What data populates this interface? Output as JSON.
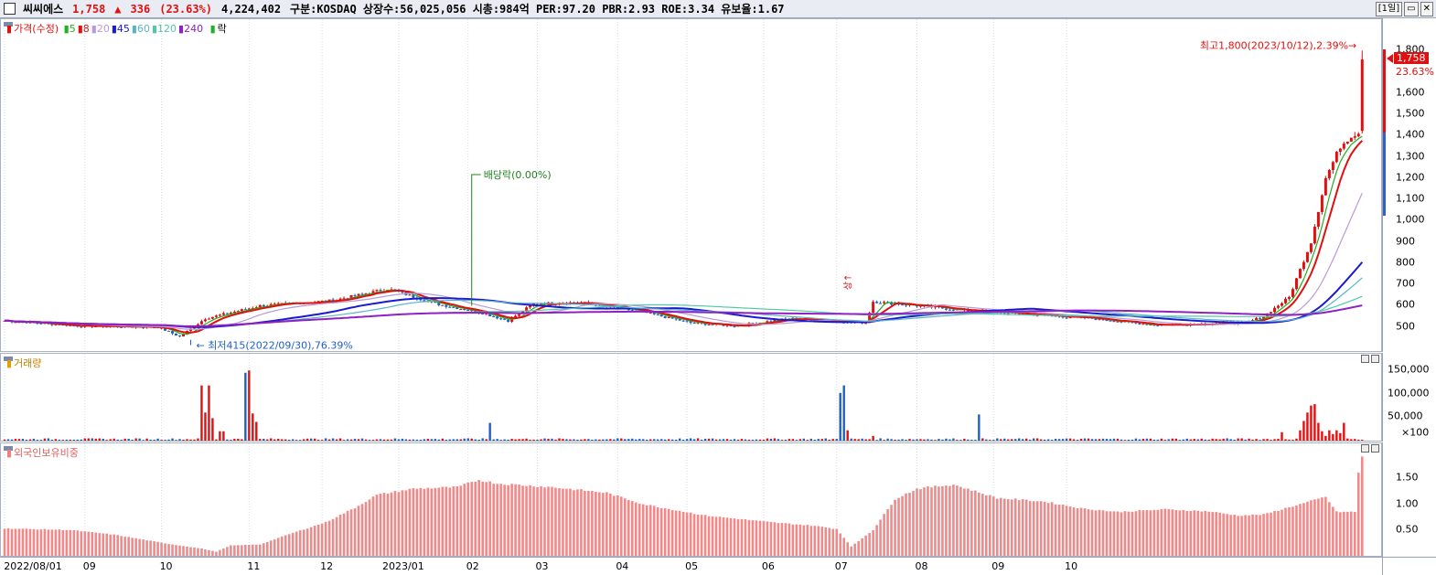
{
  "header": {
    "name": "씨씨에스",
    "price": "1,758",
    "change_arrow": "▲",
    "change": "336",
    "change_pct": "(23.63%)",
    "volume": "4,224,402",
    "info": "구분:KOSDAQ 상장수:56,025,056 시총:984억 PER:97.20 PBR:2.93 ROE:3.34 유보율:1.67",
    "period_button": "[1일]",
    "min_button": "▭",
    "close_button": "✕"
  },
  "legend": {
    "price_label": "가격(수정)",
    "ma": [
      "5",
      "8",
      "20",
      "45",
      "60",
      "120",
      "240"
    ],
    "ma_colors": [
      "#20b020",
      "#e01010",
      "#b89ad6",
      "#1a1ad0",
      "#5ab4c8",
      "#52c8a8",
      "#9020c0"
    ],
    "fall_label": "락",
    "volume_label": "거래량",
    "foreign_label": "외국인보유비중"
  },
  "annotations": {
    "high": "최고1,800(2023/10/12),2.39%",
    "low": "최저415(2022/09/30),76.39%",
    "dividend": "배당락(0.00%)",
    "up_marker": "상",
    "current_price": "1,758",
    "current_pct": "23.63%"
  },
  "chart_data": [
    {
      "type": "candlestick",
      "title": "가격(수정)",
      "ylim": [
        400,
        1870
      ],
      "yticks": [
        500,
        600,
        700,
        800,
        900,
        1000,
        1100,
        1200,
        1300,
        1400,
        1500,
        1600,
        1800
      ],
      "ytick_labels": [
        "500",
        "600",
        "700",
        "800",
        "900",
        "1,000",
        "1,100",
        "1,200",
        "1,300",
        "1,400",
        "1,500",
        "1,600",
        "1,800"
      ],
      "x_tick_labels": [
        "2022/08/01",
        "09",
        "10",
        "11",
        "12",
        "2023/01",
        "02",
        "03",
        "04",
        "05",
        "06",
        "07",
        "08",
        "09",
        "10"
      ],
      "anchors": [
        [
          0,
          530
        ],
        [
          20,
          505
        ],
        [
          42,
          500
        ],
        [
          48,
          455
        ],
        [
          55,
          540
        ],
        [
          70,
          600
        ],
        [
          90,
          625
        ],
        [
          105,
          680
        ],
        [
          118,
          610
        ],
        [
          130,
          570
        ],
        [
          138,
          530
        ],
        [
          145,
          610
        ],
        [
          158,
          615
        ],
        [
          175,
          570
        ],
        [
          188,
          520
        ],
        [
          200,
          505
        ],
        [
          215,
          540
        ],
        [
          236,
          520
        ],
        [
          238,
          620
        ],
        [
          250,
          600
        ],
        [
          262,
          580
        ],
        [
          280,
          560
        ],
        [
          298,
          540
        ],
        [
          315,
          510
        ],
        [
          340,
          520
        ],
        [
          345,
          550
        ],
        [
          352,
          640
        ],
        [
          358,
          900
        ],
        [
          362,
          1200
        ],
        [
          366,
          1350
        ],
        [
          369,
          1400
        ],
        [
          372,
          1420
        ]
      ],
      "last_candle": {
        "open": 1422,
        "high": 1800,
        "low": 1410,
        "close": 1758
      },
      "ma_series": [
        {
          "name": "5",
          "color": "#20b020"
        },
        {
          "name": "8",
          "color": "#e01010"
        },
        {
          "name": "20",
          "color": "#b89ad6"
        },
        {
          "name": "45",
          "color": "#1a1ad0"
        },
        {
          "name": "60",
          "color": "#5ab4c8"
        },
        {
          "name": "120",
          "color": "#52c8a8"
        },
        {
          "name": "240",
          "color": "#9020c0"
        }
      ]
    },
    {
      "type": "bar",
      "title": "거래량",
      "ylim": [
        0,
        170000
      ],
      "yticks": [
        50000,
        100000,
        150000
      ],
      "ytick_labels": [
        "50,000",
        "100,000",
        "150,000"
      ],
      "unit_label": "×100",
      "spikes": [
        [
          54,
          118000
        ],
        [
          55,
          60000
        ],
        [
          56,
          118000
        ],
        [
          57,
          48000
        ],
        [
          59,
          20000
        ],
        [
          60,
          20000
        ],
        [
          66,
          145000
        ],
        [
          67,
          150000
        ],
        [
          68,
          58000
        ],
        [
          69,
          40000
        ],
        [
          133,
          38000
        ],
        [
          229,
          102000
        ],
        [
          230,
          118000
        ],
        [
          231,
          22000
        ],
        [
          238,
          10000
        ],
        [
          267,
          56000
        ],
        [
          350,
          18000
        ],
        [
          355,
          22000
        ],
        [
          356,
          42000
        ],
        [
          357,
          60000
        ],
        [
          358,
          75000
        ],
        [
          359,
          78000
        ],
        [
          360,
          38000
        ],
        [
          361,
          20000
        ],
        [
          362,
          10000
        ],
        [
          363,
          22000
        ],
        [
          364,
          14000
        ],
        [
          365,
          22000
        ],
        [
          366,
          16000
        ],
        [
          367,
          38000
        ]
      ]
    },
    {
      "type": "bar",
      "title": "외국인보유비중",
      "ylim": [
        0,
        2.0
      ],
      "yticks": [
        0.5,
        1.0,
        1.5
      ],
      "ytick_labels": [
        "0.50",
        "1.00",
        "1.50"
      ],
      "anchors": [
        [
          0,
          0.53
        ],
        [
          18,
          0.5
        ],
        [
          30,
          0.41
        ],
        [
          45,
          0.23
        ],
        [
          54,
          0.14
        ],
        [
          58,
          0.08
        ],
        [
          62,
          0.2
        ],
        [
          70,
          0.22
        ],
        [
          78,
          0.42
        ],
        [
          88,
          0.65
        ],
        [
          96,
          0.93
        ],
        [
          102,
          1.18
        ],
        [
          112,
          1.3
        ],
        [
          124,
          1.33
        ],
        [
          130,
          1.47
        ],
        [
          135,
          1.4
        ],
        [
          150,
          1.33
        ],
        [
          165,
          1.22
        ],
        [
          175,
          1.0
        ],
        [
          192,
          0.78
        ],
        [
          210,
          0.65
        ],
        [
          222,
          0.58
        ],
        [
          228,
          0.52
        ],
        [
          232,
          0.18
        ],
        [
          238,
          0.5
        ],
        [
          244,
          1.1
        ],
        [
          250,
          1.3
        ],
        [
          260,
          1.38
        ],
        [
          272,
          1.12
        ],
        [
          285,
          1.05
        ],
        [
          295,
          0.92
        ],
        [
          305,
          0.85
        ],
        [
          318,
          0.9
        ],
        [
          330,
          0.86
        ],
        [
          338,
          0.78
        ],
        [
          345,
          0.8
        ],
        [
          355,
          1.0
        ],
        [
          362,
          1.14
        ],
        [
          365,
          0.85
        ],
        [
          370,
          0.85
        ],
        [
          371,
          1.6
        ],
        [
          372,
          1.93
        ]
      ]
    }
  ]
}
